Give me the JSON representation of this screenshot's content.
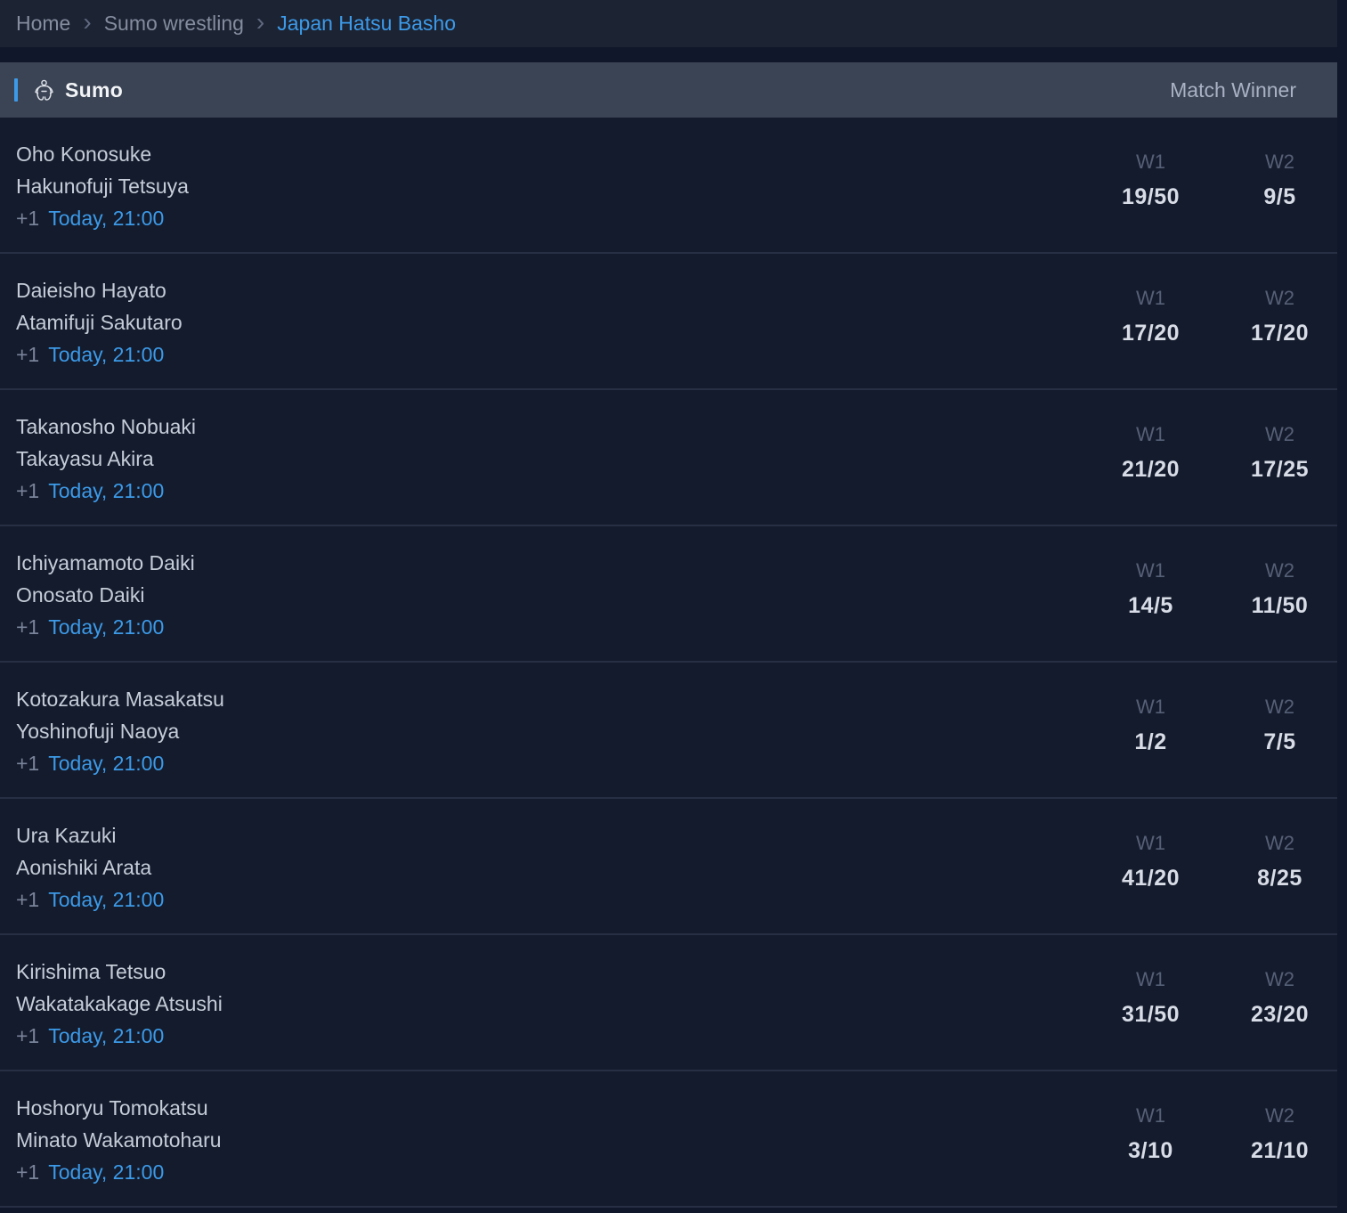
{
  "breadcrumb": {
    "items": [
      {
        "label": "Home",
        "active": false
      },
      {
        "label": "Sumo wrestling",
        "active": false
      },
      {
        "label": "Japan Hatsu Basho",
        "active": true
      }
    ]
  },
  "section": {
    "title": "Sumo",
    "icon": "sumo-wrestler-icon",
    "market_header": "Match Winner"
  },
  "odds_labels": {
    "w1": "W1",
    "w2": "W2"
  },
  "matches": [
    {
      "player1": "Oho Konosuke",
      "player2": "Hakunofuji Tetsuya",
      "more": "+1",
      "time": "Today, 21:00",
      "w1": "19/50",
      "w2": "9/5"
    },
    {
      "player1": "Daieisho Hayato",
      "player2": "Atamifuji Sakutaro",
      "more": "+1",
      "time": "Today, 21:00",
      "w1": "17/20",
      "w2": "17/20"
    },
    {
      "player1": "Takanosho Nobuaki",
      "player2": "Takayasu Akira",
      "more": "+1",
      "time": "Today, 21:00",
      "w1": "21/20",
      "w2": "17/25"
    },
    {
      "player1": "Ichiyamamoto Daiki",
      "player2": "Onosato Daiki",
      "more": "+1",
      "time": "Today, 21:00",
      "w1": "14/5",
      "w2": "11/50"
    },
    {
      "player1": "Kotozakura Masakatsu",
      "player2": "Yoshinofuji Naoya",
      "more": "+1",
      "time": "Today, 21:00",
      "w1": "1/2",
      "w2": "7/5"
    },
    {
      "player1": "Ura Kazuki",
      "player2": "Aonishiki Arata",
      "more": "+1",
      "time": "Today, 21:00",
      "w1": "41/20",
      "w2": "8/25"
    },
    {
      "player1": "Kirishima Tetsuo",
      "player2": "Wakatakakage Atsushi",
      "more": "+1",
      "time": "Today, 21:00",
      "w1": "31/50",
      "w2": "23/20"
    },
    {
      "player1": "Hoshoryu Tomokatsu",
      "player2": "Minato Wakamotoharu",
      "more": "+1",
      "time": "Today, 21:00",
      "w1": "3/10",
      "w2": "21/10"
    }
  ],
  "colors": {
    "accent_blue": "#3c9ae8",
    "header_bg": "#3b4454",
    "row_bg": "#141b2c",
    "page_bg": "#10172a"
  }
}
